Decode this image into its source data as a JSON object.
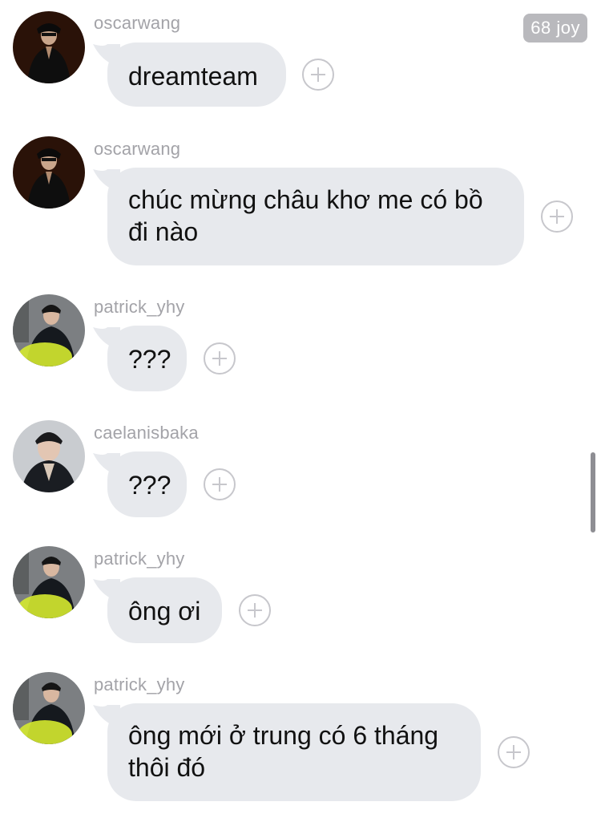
{
  "badge": {
    "label": "68 joy"
  },
  "colors": {
    "bubble": "#e7e9ed",
    "username": "#a3a3a8",
    "plus_icon": "#c7c7cc",
    "badge": "#b9b9bd"
  },
  "messages": [
    {
      "username": "oscarwang",
      "avatar": "oscarwang-avatar",
      "lines": [
        "dreamteam"
      ]
    },
    {
      "username": "oscarwang",
      "avatar": "oscarwang-avatar",
      "lines": [
        "chúc mừng châu khơ me có bồ",
        "đi nào"
      ]
    },
    {
      "username": "patrick_yhy",
      "avatar": "patrick-avatar",
      "lines": [
        "???"
      ]
    },
    {
      "username": "caelanisbaka",
      "avatar": "caelan-avatar",
      "lines": [
        "???"
      ]
    },
    {
      "username": "patrick_yhy",
      "avatar": "patrick-avatar",
      "lines": [
        "ông ơi"
      ]
    },
    {
      "username": "patrick_yhy",
      "avatar": "patrick-avatar",
      "lines": [
        "ông mới ở trung có 6 tháng",
        "thôi đó"
      ]
    }
  ]
}
